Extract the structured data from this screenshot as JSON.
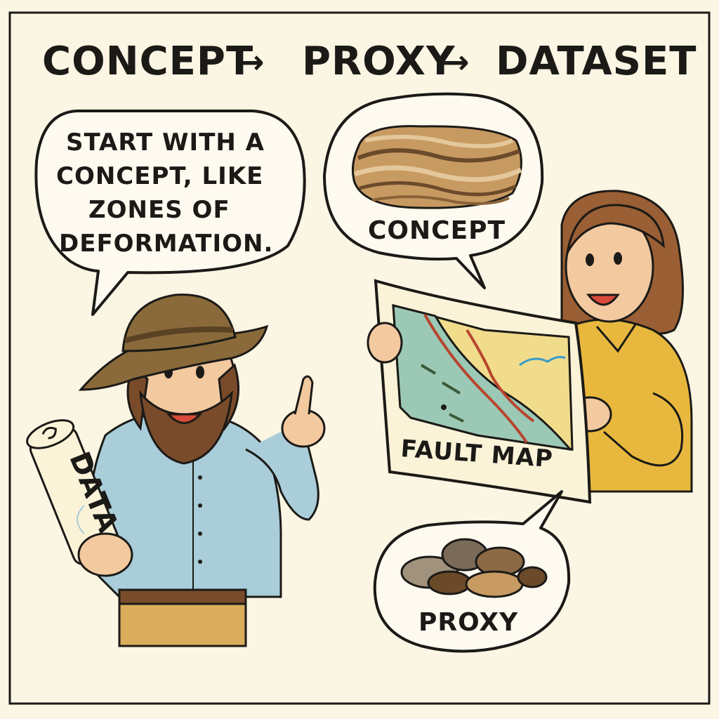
{
  "title": {
    "part1": "CONCEPT",
    "part2": "PROXY",
    "part3": "DATASET",
    "arrow": "→"
  },
  "speech_bubble": {
    "lines": [
      "START WITH A",
      "CONCEPT, LIKE",
      "ZONES OF",
      "DEFORMATION."
    ]
  },
  "concept_bubble": {
    "label": "CONCEPT"
  },
  "map": {
    "label": "FAULT MAP"
  },
  "proxy_bubble": {
    "label": "PROXY"
  },
  "scroll": {
    "label": "DATA"
  },
  "colors": {
    "background": "#fbf5e3",
    "ink": "#1b1a17",
    "hat": "#8a6a3a",
    "shirt_blue": "#a9cdd9",
    "shirt_yellow": "#e8b83e",
    "skin": "#f3c9a0",
    "hair_brown": "#7a4b2a",
    "map_green": "#9cc9b6",
    "map_yellow": "#f1dc8c",
    "fault_red": "#b8452f"
  }
}
